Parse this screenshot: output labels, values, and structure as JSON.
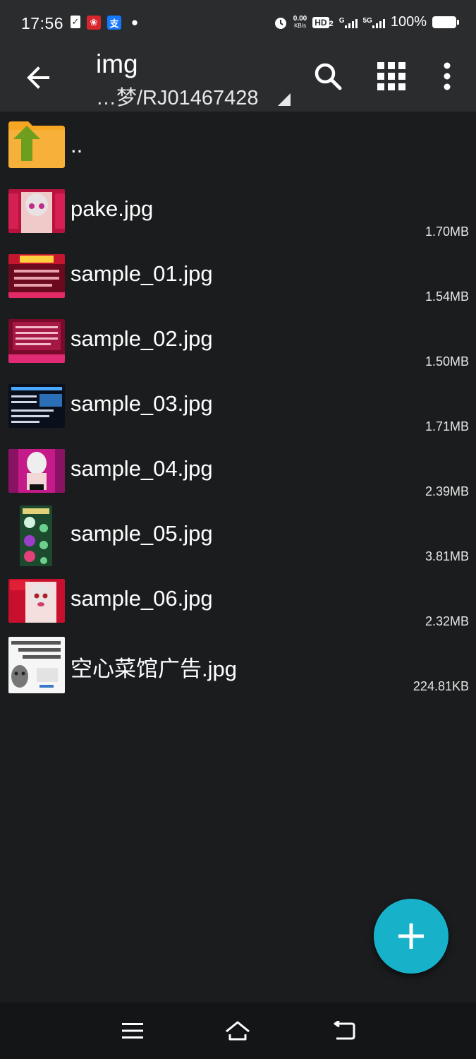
{
  "status": {
    "time": "17:56",
    "net_speed_value": "0.00",
    "net_speed_unit": "KB/s",
    "hd_label": "HD",
    "hd_sub": "2",
    "sig1_label": "G",
    "sig2_label": "5G",
    "battery": "100%"
  },
  "appbar": {
    "title": "img",
    "path": "…梦/RJ01467428"
  },
  "parent_item": {
    "label": ".."
  },
  "files": [
    {
      "name": "pake.jpg",
      "size": "1.70MB"
    },
    {
      "name": "sample_01.jpg",
      "size": "1.54MB"
    },
    {
      "name": "sample_02.jpg",
      "size": "1.50MB"
    },
    {
      "name": "sample_03.jpg",
      "size": "1.71MB"
    },
    {
      "name": "sample_04.jpg",
      "size": "2.39MB"
    },
    {
      "name": "sample_05.jpg",
      "size": "3.81MB"
    },
    {
      "name": "sample_06.jpg",
      "size": "2.32MB"
    },
    {
      "name": "空心菜馆广告.jpg",
      "size": "224.81KB"
    }
  ],
  "colors": {
    "background": "#1b1c1e",
    "appbar": "#2b2c2e",
    "fab": "#17b2c9",
    "folder": "#f5a623",
    "folder_arrow": "#6d9e1e"
  }
}
